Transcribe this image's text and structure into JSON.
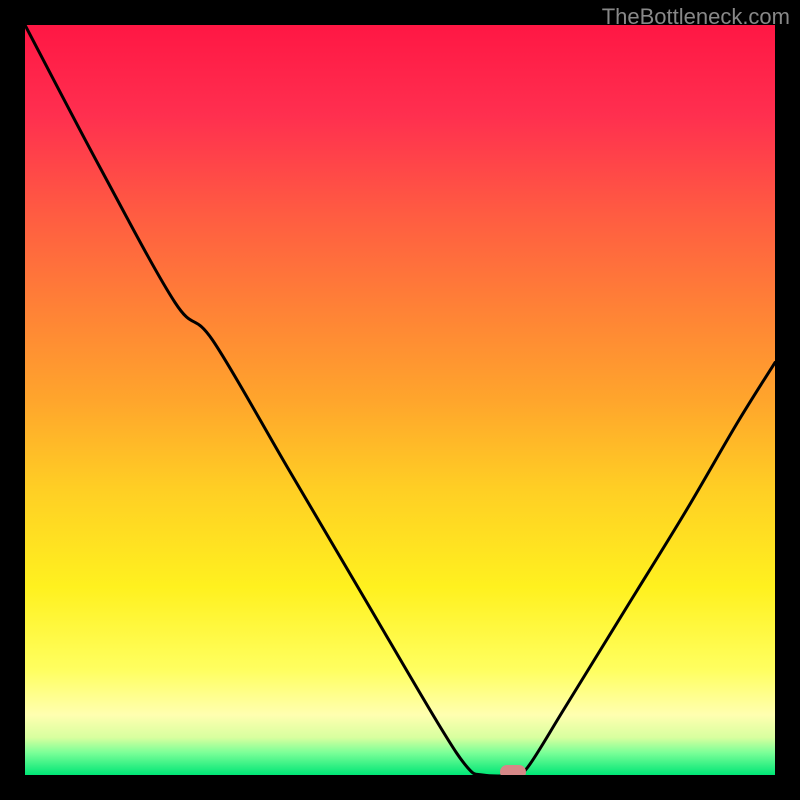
{
  "watermark": "TheBottleneck.com",
  "chart_data": {
    "type": "line",
    "title": "",
    "xlabel": "",
    "ylabel": "",
    "xlim": [
      0,
      100
    ],
    "ylim": [
      0,
      100
    ],
    "curve": [
      {
        "x": 0,
        "y": 100
      },
      {
        "x": 10,
        "y": 81
      },
      {
        "x": 20,
        "y": 63
      },
      {
        "x": 25,
        "y": 58
      },
      {
        "x": 35,
        "y": 41
      },
      {
        "x": 45,
        "y": 24
      },
      {
        "x": 55,
        "y": 7
      },
      {
        "x": 59,
        "y": 1
      },
      {
        "x": 61,
        "y": 0
      },
      {
        "x": 65,
        "y": 0
      },
      {
        "x": 67,
        "y": 1
      },
      {
        "x": 72,
        "y": 9
      },
      {
        "x": 80,
        "y": 22
      },
      {
        "x": 88,
        "y": 35
      },
      {
        "x": 95,
        "y": 47
      },
      {
        "x": 100,
        "y": 55
      }
    ],
    "marker": {
      "x": 65,
      "y": 0
    },
    "colors": {
      "top": "#ff1744",
      "mid": "#ffd21f",
      "bottom": "#00e676",
      "curve": "#000000",
      "marker": "#d68787",
      "frame": "#000000"
    }
  }
}
